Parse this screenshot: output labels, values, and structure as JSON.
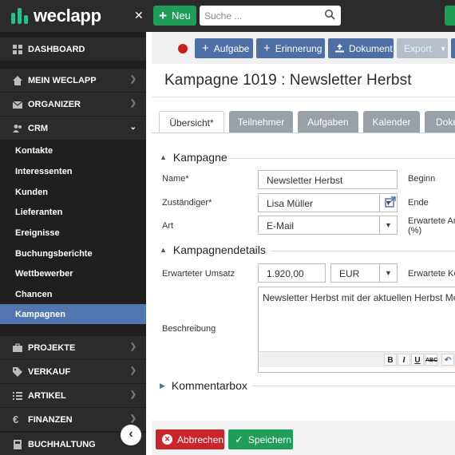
{
  "app": {
    "logo_text": "weclapp",
    "brand_green": "#1e9e58",
    "nav_blue": "#4d6fa5",
    "active_blue": "#5176b0"
  },
  "topbar": {
    "collapse_icon": "✕",
    "new_label": "Neu",
    "search_placeholder": "Suche ..."
  },
  "sidebar": {
    "dashboard": "DASHBOARD",
    "mein_weclapp": "MEIN WECLAPP",
    "organizer": "ORGANIZER",
    "crm": "CRM",
    "crm_items": [
      "Kontakte",
      "Interessenten",
      "Kunden",
      "Lieferanten",
      "Ereignisse",
      "Buchungsberichte",
      "Wettbewerber",
      "Chancen",
      "Kampagnen"
    ],
    "projekte": "PROJEKTE",
    "verkauf": "VERKAUF",
    "artikel": "ARTIKEL",
    "finanzen": "FINANZEN",
    "buchhaltung": "BUCHHALTUNG"
  },
  "toolbar": {
    "aufgabe": "Aufgabe",
    "erinnerung": "Erinnerung",
    "dokument": "Dokument",
    "export": "Export"
  },
  "page": {
    "title": "Kampagne 1019 : Newsletter Herbst"
  },
  "tabs": [
    "Übersicht*",
    "Teilnehmer",
    "Aufgaben",
    "Kalender",
    "Doku"
  ],
  "kampagne": {
    "heading": "Kampagne",
    "name_label": "Name*",
    "name_value": "Newsletter Herbst",
    "zustaendiger_label": "Zuständiger*",
    "zustaendiger_value": "Lisa Müller",
    "art_label": "Art",
    "art_value": "E-Mail",
    "beginn_label": "Beginn",
    "ende_label": "Ende",
    "erwartete_label_1": "Erwartete An",
    "erwartete_label_2": "(%)"
  },
  "details": {
    "heading": "Kampagnendetails",
    "umsatz_label": "Erwarteter Umsatz",
    "umsatz_value": "1.920,00",
    "currency_value": "EUR",
    "kosten_label": "Erwartete Ko",
    "beschreibung_label": "Beschreibung",
    "beschreibung_value": "Newsletter Herbst mit der aktuellen Herbst Mode",
    "editor": [
      "B",
      "I",
      "U",
      "ABC"
    ]
  },
  "kommentar": {
    "heading": "Kommentarbox"
  },
  "footer": {
    "abbrechen": "Abbrechen",
    "speichern": "Speichern"
  }
}
